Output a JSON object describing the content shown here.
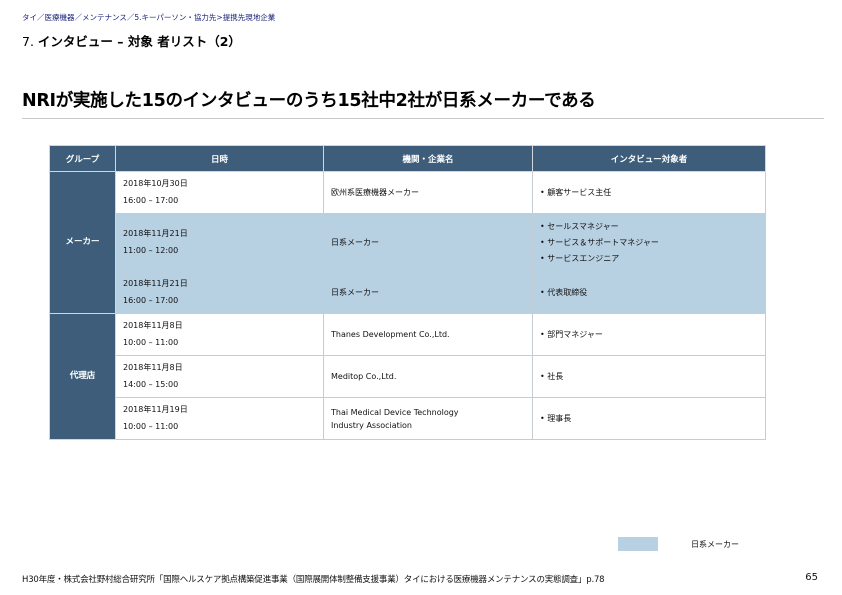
{
  "breadcrumb": "タイ／医療機器／メンテナンス／5.キーパーソン・協力先>提携先現地企業",
  "subtitle": {
    "number": "7.",
    "label": "インタビュー – 対象 者リスト（2）"
  },
  "headline": "NRIが実施した15のインタビューのうち15社中2社が日系メーカーである",
  "table": {
    "headers": [
      "グループ",
      "日時",
      "機関・企業名",
      "インタビュー対象者"
    ],
    "groups": [
      {
        "name": "メーカー",
        "rows": [
          {
            "date": "2018年10月30日",
            "time": "16:00 – 17:00",
            "org_line1": "欧州系医療機器メーカー",
            "org_line2": "",
            "persons": [
              "• 顧客サービス主任"
            ],
            "japanese": false
          },
          {
            "date": "2018年11月21日",
            "time": "11:00 – 12:00",
            "org_line1": "日系メーカー",
            "org_line2": "",
            "persons": [
              "• セールスマネジャー",
              "• サービス＆サポートマネジャー",
              "• サービスエンジニア"
            ],
            "japanese": true
          },
          {
            "date": "2018年11月21日",
            "time": "16:00 – 17:00",
            "org_line1": "日系メーカー",
            "org_line2": "",
            "persons": [
              "• 代表取締役"
            ],
            "japanese": true
          }
        ]
      },
      {
        "name": "代理店",
        "rows": [
          {
            "date": "2018年11月8日",
            "time": "10:00 – 11:00",
            "org_line1": "Thanes Development Co.,Ltd.",
            "org_line2": "",
            "persons": [
              "• 部門マネジャー"
            ],
            "japanese": false
          },
          {
            "date": "2018年11月8日",
            "time": "14:00 – 15:00",
            "org_line1": "Meditop Co.,Ltd.",
            "org_line2": "",
            "persons": [
              "• 社長"
            ],
            "japanese": false
          },
          {
            "date": "2018年11月19日",
            "time": "10:00 – 11:00",
            "org_line1": "Thai Medical Device Technology",
            "org_line2": "Industry Association",
            "persons": [
              "• 理事長"
            ],
            "japanese": false
          }
        ]
      }
    ]
  },
  "legend": {
    "label": "日系メーカー",
    "color": "#b7d0e2"
  },
  "colors": {
    "header_bg": "#3d5d7a",
    "highlight": "#b7d0e2",
    "breadcrumb": "#1a237e"
  },
  "footer": {
    "source": "H30年度・株式会社野村総合研究所「国際ヘルスケア拠点構築促進事業（国際展開体制整備支援事業）タイにおける医療機器メンテナンスの実態調査」p.78",
    "page": "65"
  }
}
